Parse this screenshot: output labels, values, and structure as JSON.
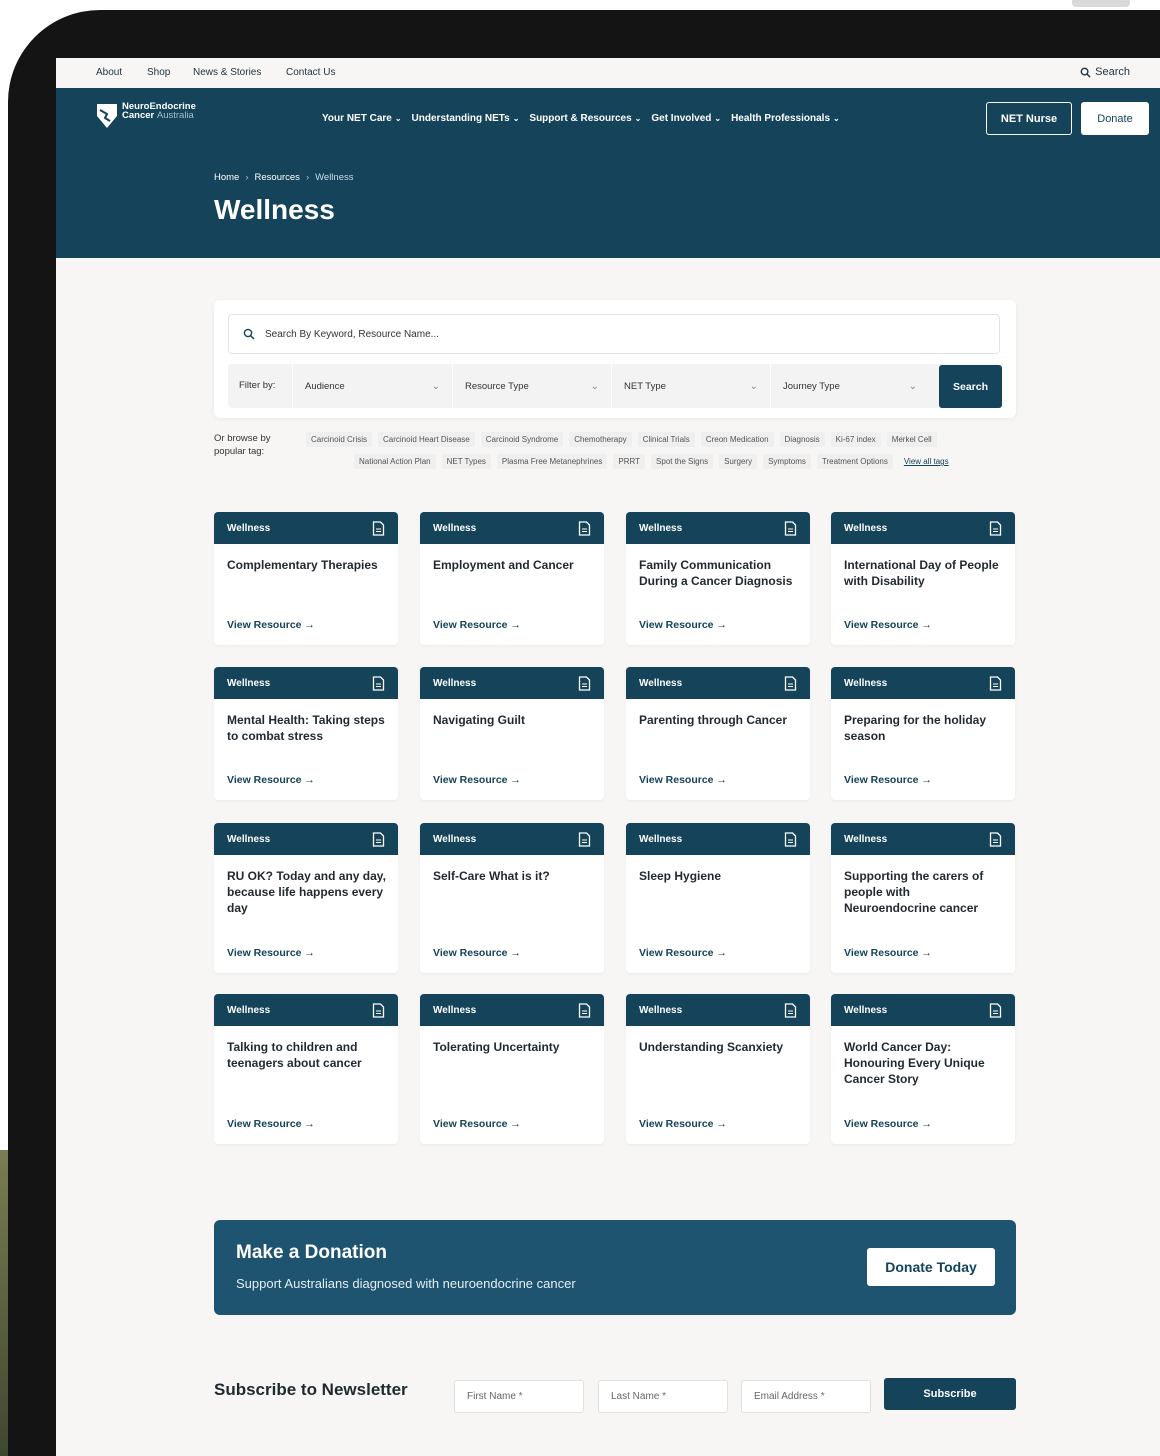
{
  "utility_nav": {
    "items": [
      "About",
      "Shop",
      "News & Stories",
      "Contact Us"
    ],
    "search_label": "Search"
  },
  "brand": {
    "line1": "NeuroEndocrine",
    "line2_bold": "Cancer",
    "line2_light": "Australia"
  },
  "main_nav": {
    "items": [
      "Your NET Care",
      "Understanding NETs",
      "Support & Resources",
      "Get Involved",
      "Health Professionals"
    ],
    "net_nurse_label": "NET Nurse",
    "donate_label": "Donate"
  },
  "breadcrumb": {
    "items": [
      "Home",
      "Resources",
      "Wellness"
    ],
    "separator": "›"
  },
  "page_title": "Wellness",
  "search": {
    "placeholder": "Search By Keyword, Resource Name...",
    "filter_label": "Filter by:",
    "filters": [
      "Audience",
      "Resource Type",
      "NET Type",
      "Journey Type"
    ],
    "button_label": "Search"
  },
  "tags": {
    "label": "Or browse by popular tag:",
    "row1": [
      "Carcinoid Crisis",
      "Carcinoid Heart Disease",
      "Carcinoid Syndrome",
      "Chemotherapy",
      "Clinical Trials",
      "Creon Medication",
      "Diagnosis",
      "Ki-67 index",
      "Merkel Cell"
    ],
    "row2": [
      "National Action Plan",
      "NET Types",
      "Plasma Free Metanephrines",
      "PRRT",
      "Spot the Signs",
      "Surgery",
      "Symptoms",
      "Treatment Options"
    ],
    "view_all": "View all tags"
  },
  "resources": {
    "category": "Wellness",
    "link_label": "View Resource →",
    "items": [
      "Complementary Therapies",
      "Employment and Cancer",
      "Family Communication During a Cancer Diagnosis",
      "International Day of People with Disability",
      "Mental Health: Taking steps to combat stress",
      "Navigating Guilt",
      "Parenting through Cancer",
      "Preparing for the holiday season",
      "RU OK? Today and any day, because life happens every day",
      "Self-Care What is it?",
      "Sleep Hygiene",
      "Supporting the carers of people with Neuroendocrine cancer",
      "Talking to children and teenagers about cancer",
      "Tolerating Uncertainty",
      "Understanding Scanxiety",
      "World Cancer Day: Honouring Every Unique Cancer Story"
    ]
  },
  "donation": {
    "title": "Make a Donation",
    "subtitle": "Support Australians diagnosed with neuroendocrine cancer",
    "button_label": "Donate Today"
  },
  "newsletter": {
    "title": "Subscribe to Newsletter",
    "first_name_placeholder": "First Name *",
    "last_name_placeholder": "Last Name *",
    "email_placeholder": "Email Address *",
    "button_label": "Subscribe"
  },
  "colors": {
    "primary": "#14435a",
    "banner": "#1e5470",
    "background": "#f7f6f4"
  }
}
